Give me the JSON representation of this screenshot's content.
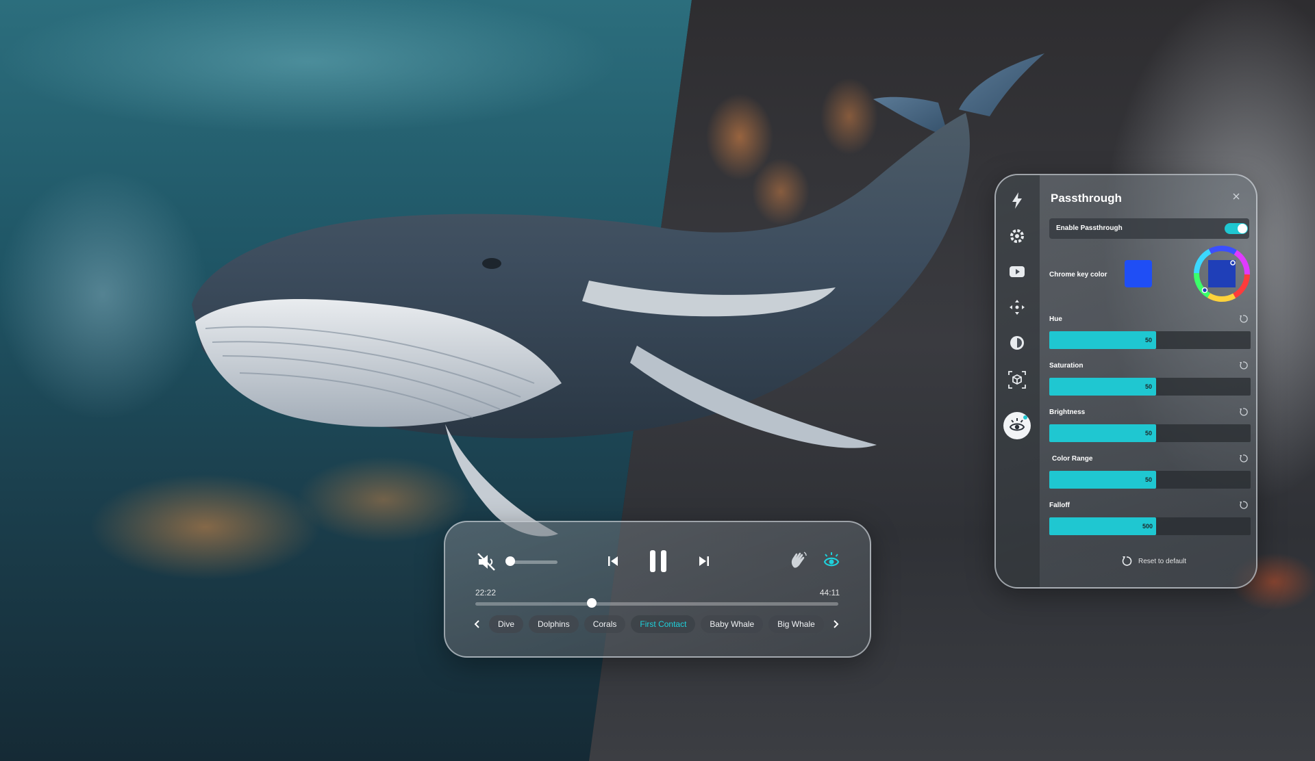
{
  "player": {
    "time_current": "22:22",
    "time_total": "44:11",
    "progress_fraction": 0.32,
    "volume_fraction": 0.04,
    "icons": {
      "mute": "speaker-muted-icon",
      "prev": "skip-previous-icon",
      "pause": "pause-icon",
      "next": "skip-next-icon",
      "hand": "hand-wave-icon",
      "eye": "passthrough-eye-icon",
      "left": "chevron-left-icon",
      "right": "chevron-right-icon"
    },
    "chapters": [
      {
        "label": "Dive",
        "active": false
      },
      {
        "label": "Dolphins",
        "active": false
      },
      {
        "label": "Corals",
        "active": false
      },
      {
        "label": "First Contact",
        "active": true
      },
      {
        "label": "Baby Whale",
        "active": false
      },
      {
        "label": "Big Whale",
        "active": false
      }
    ]
  },
  "panel": {
    "title": "Passthrough",
    "enable_label": "Enable Passthrough",
    "enabled": true,
    "chroma_label": "Chrome key color",
    "chroma_color": "#1f4ef5",
    "accent_color": "#1fc7d1",
    "sidebar_icons": [
      "lightning-icon",
      "gear-icon",
      "video-play-icon",
      "move-arrows-icon",
      "brightness-icon",
      "3d-cube-icon",
      "passthrough-eye-icon"
    ],
    "sliders": [
      {
        "label": "Hue",
        "value": "50",
        "fraction": 0.5
      },
      {
        "label": "Saturation",
        "value": "50",
        "fraction": 0.5
      },
      {
        "label": "Brightness",
        "value": "50",
        "fraction": 0.5
      },
      {
        "label": "Color Range",
        "value": "50",
        "fraction": 0.5
      },
      {
        "label": "Falloff",
        "value": "500",
        "fraction": 0.5
      }
    ],
    "reset_label": "Reset to default"
  }
}
